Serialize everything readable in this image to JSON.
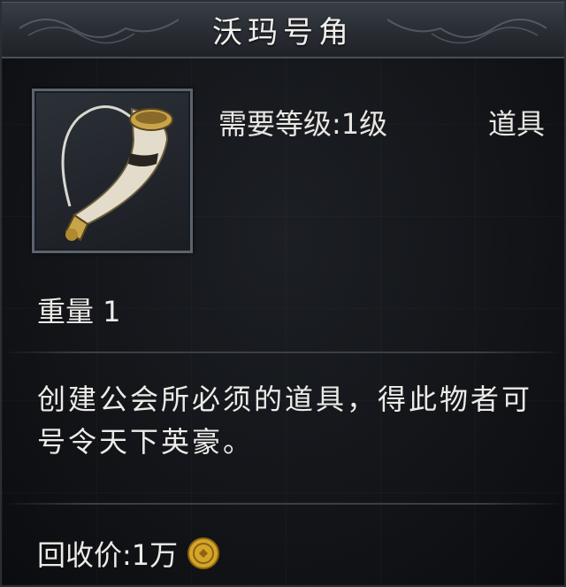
{
  "item": {
    "name": "沃玛号角",
    "level_requirement": "需要等级:1级",
    "type": "道具",
    "weight": "重量 1",
    "description": "创建公会所必须的道具，得此物者可号令天下英豪。",
    "recycle_price": "回收价:1万",
    "icon": "horn-icon",
    "currency_icon": "gold-coin-icon"
  },
  "colors": {
    "text": "#e8e6e1",
    "frame": "#5a6470",
    "coin": "#d4a52a"
  }
}
